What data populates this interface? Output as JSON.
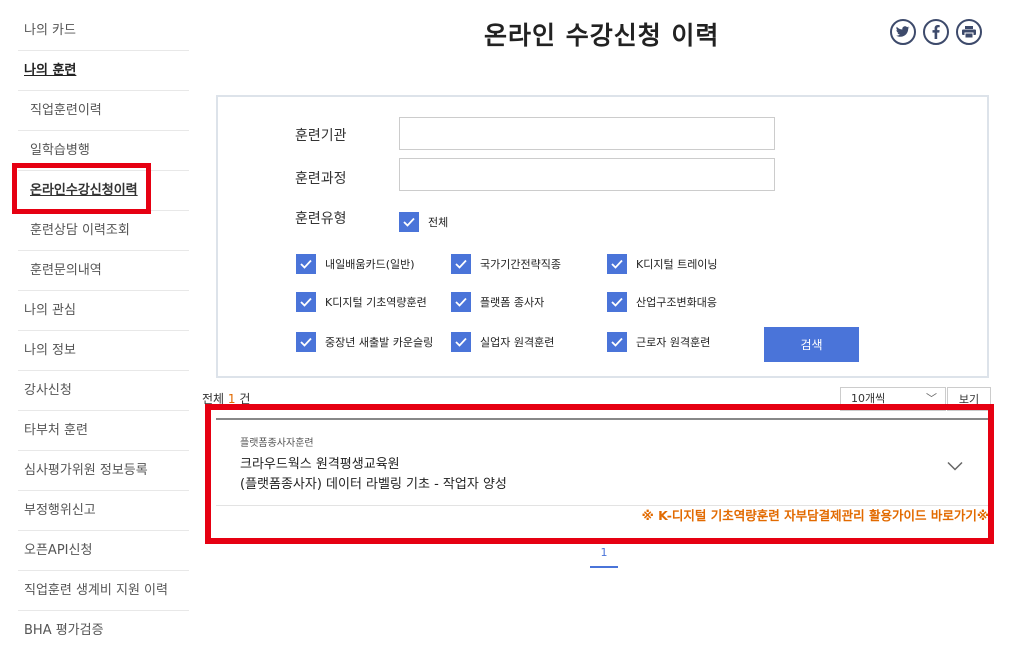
{
  "sidebar": {
    "items": [
      {
        "label": "나의 카드"
      },
      {
        "label": "나의 훈련"
      },
      {
        "label": "직업훈련이력"
      },
      {
        "label": "일학습병행"
      },
      {
        "label": "온라인수강신청이력"
      },
      {
        "label": "훈련상담 이력조회"
      },
      {
        "label": "훈련문의내역"
      },
      {
        "label": "나의 관심"
      },
      {
        "label": "나의 정보"
      },
      {
        "label": "강사신청"
      },
      {
        "label": "타부처 훈련"
      },
      {
        "label": "심사평가위원 정보등록"
      },
      {
        "label": "부정행위신고"
      },
      {
        "label": "오픈API신청"
      },
      {
        "label": "직업훈련 생계비 지원 이력"
      },
      {
        "label": "BHA 평가검증"
      }
    ]
  },
  "page_title": "온라인 수강신청 이력",
  "share": {
    "twitter": "twitter-icon",
    "facebook": "facebook-icon",
    "print": "print-icon"
  },
  "search": {
    "institution_label": "훈련기관",
    "institution_value": "",
    "course_label": "훈련과정",
    "course_value": "",
    "type_label": "훈련유형",
    "all_label": "전체",
    "types": [
      "내일배움카드(일반)",
      "국가기간전략직종",
      "K디지털 트레이닝",
      "K디지털 기초역량훈련",
      "플랫폼 종사자",
      "산업구조변화대응",
      "중장년 새출발 카운슬링",
      "실업자 원격훈련",
      "근로자 원격훈련"
    ],
    "search_button": "검색"
  },
  "results": {
    "total_prefix": "전체 ",
    "total_count": "1",
    "total_suffix": " 건",
    "per_page": "10개씩",
    "view_button": "보기",
    "items": [
      {
        "category": "플랫폼종사자훈련",
        "institution": "크라우드웍스 원격평생교육원",
        "course": "(플랫폼종사자) 데이터 라벨링 기초 - 작업자 양성"
      }
    ],
    "guide_link": "※ K-디지털 기초역량훈련 자부담결제관리 활용가이드 바로가기※"
  },
  "pagination": {
    "current": "1"
  },
  "colors": {
    "accent": "#4a74d9",
    "highlight": "#e60012",
    "link": "#e26a00"
  }
}
